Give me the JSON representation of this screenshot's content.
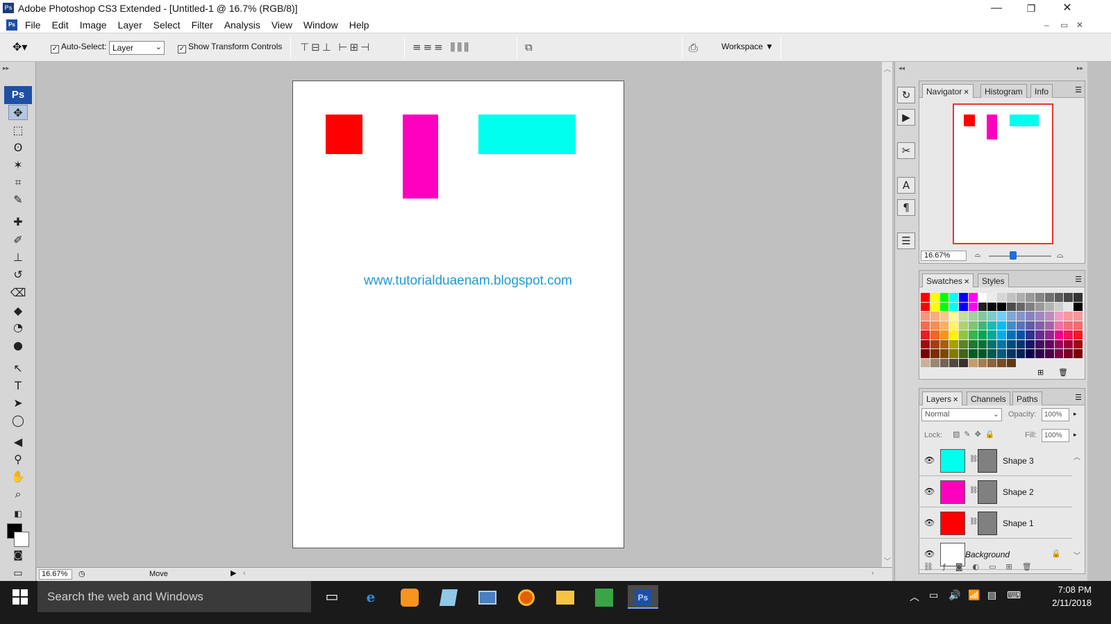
{
  "window": {
    "title": "Adobe Photoshop CS3 Extended - [Untitled-1 @ 16.7% (RGB/8)]",
    "app_icon": "Ps",
    "controls": {
      "minimize": "—",
      "restore": "❐",
      "close": "✕"
    }
  },
  "menu": {
    "items": [
      "File",
      "Edit",
      "Image",
      "Layer",
      "Select",
      "Filter",
      "Analysis",
      "View",
      "Window",
      "Help"
    ],
    "doc_controls": {
      "minimize": "–",
      "restore": "▭",
      "close": "✕"
    }
  },
  "options": {
    "auto_select_label": "Auto-Select:",
    "auto_select_checked": true,
    "auto_select_value": "Layer",
    "show_transform_label": "Show Transform Controls",
    "show_transform_checked": true,
    "workspace_label": "Workspace ▼"
  },
  "toolbox": {
    "logo": "Ps",
    "tools": [
      {
        "name": "move-tool",
        "glyph": "✥",
        "active": true
      },
      {
        "name": "marquee-tool",
        "glyph": "⬚",
        "active": false
      },
      {
        "name": "lasso-tool",
        "glyph": "ʘ",
        "active": false
      },
      {
        "name": "magic-wand-tool",
        "glyph": "✶",
        "active": false
      },
      {
        "name": "crop-tool",
        "glyph": "⌗",
        "active": false
      },
      {
        "name": "slice-tool",
        "glyph": "✎",
        "active": false
      },
      {
        "name": "healing-brush-tool",
        "glyph": "✚",
        "active": false
      },
      {
        "name": "brush-tool",
        "glyph": "✐",
        "active": false
      },
      {
        "name": "clone-stamp-tool",
        "glyph": "⊥",
        "active": false
      },
      {
        "name": "history-brush-tool",
        "glyph": "↺",
        "active": false
      },
      {
        "name": "eraser-tool",
        "glyph": "⌫",
        "active": false
      },
      {
        "name": "paint-bucket-tool",
        "glyph": "◆",
        "active": false
      },
      {
        "name": "blur-tool",
        "glyph": "◔",
        "active": false
      },
      {
        "name": "dodge-tool",
        "glyph": "●",
        "active": false
      },
      {
        "name": "path-selection-tool",
        "glyph": "↖",
        "active": false
      },
      {
        "name": "type-tool",
        "glyph": "T",
        "active": false
      },
      {
        "name": "direct-selection-tool",
        "glyph": "➤",
        "active": false
      },
      {
        "name": "ellipse-tool",
        "glyph": "◯",
        "active": false
      },
      {
        "name": "notes-tool",
        "glyph": "◀",
        "active": false
      },
      {
        "name": "eyedropper-tool",
        "glyph": "⚲",
        "active": false
      },
      {
        "name": "hand-tool",
        "glyph": "✋",
        "active": false
      },
      {
        "name": "zoom-tool",
        "glyph": "⌕",
        "active": false
      }
    ],
    "foreground_color": "#000000",
    "background_color": "#ffffff"
  },
  "canvas": {
    "shapes": [
      {
        "name": "shape-1-red",
        "color": "#ff0000"
      },
      {
        "name": "shape-2-magenta",
        "color": "#ff00bf"
      },
      {
        "name": "shape-3-cyan",
        "color": "#00ffee"
      }
    ],
    "watermark": "www.tutorialduaenam.blogspot.com"
  },
  "status": {
    "zoom": "16.67%",
    "tool": "Move"
  },
  "navigator": {
    "tabs": [
      "Navigator",
      "Histogram",
      "Info"
    ],
    "zoom": "16.67%"
  },
  "swatches": {
    "tabs": [
      "Swatches",
      "Styles"
    ],
    "rows": [
      [
        "#ff0000",
        "#ffff00",
        "#00ff00",
        "#00ffff",
        "#0000ff",
        "#ff00ff",
        "#ffffff",
        "#ebebeb",
        "#d6d6d6",
        "#c2c2c2",
        "#adadad",
        "#999999",
        "#858585",
        "#707070",
        "#5c5c5c",
        "#474747",
        "#333333"
      ],
      [
        "#ff0000",
        "#ffff00",
        "#00ff00",
        "#00ffff",
        "#0000ff",
        "#ff00ff",
        "#1f1f1f",
        "#0a0a0a",
        "#000000",
        "#4d4d4d",
        "#666666",
        "#808080",
        "#999999",
        "#b3b3b3",
        "#cccccc",
        "#e6e6e6",
        "#000000"
      ],
      [
        "#f7977a",
        "#f9ad81",
        "#fdc68a",
        "#fff79a",
        "#c4df9b",
        "#a2d39c",
        "#82ca9d",
        "#7bcdc8",
        "#6ecff6",
        "#7ea7d8",
        "#8493ca",
        "#8882be",
        "#a187be",
        "#bc8dbf",
        "#f49ac2",
        "#f6989d",
        "#f5989d"
      ],
      [
        "#f26c4f",
        "#f68e55",
        "#fbaf5c",
        "#fff467",
        "#acd372",
        "#7cc576",
        "#3bb878",
        "#1abbb4",
        "#00bff3",
        "#438cca",
        "#5574b9",
        "#605ca8",
        "#855fa8",
        "#a763a8",
        "#f06ea9",
        "#f26d7d",
        "#f26c6c"
      ],
      [
        "#ed1c24",
        "#f26522",
        "#f7941d",
        "#fff200",
        "#8dc73f",
        "#39b54a",
        "#00a651",
        "#00a99d",
        "#00aeef",
        "#0072bc",
        "#0054a6",
        "#2e3192",
        "#662d91",
        "#92278f",
        "#ec008c",
        "#ed145b",
        "#ed1c24"
      ],
      [
        "#9e0b0f",
        "#a0410d",
        "#a3620a",
        "#aba000",
        "#598527",
        "#1a7b30",
        "#007236",
        "#00746b",
        "#0076a3",
        "#004b80",
        "#003471",
        "#1b1464",
        "#440e62",
        "#630460",
        "#9e005d",
        "#9e0039",
        "#9e0b0f"
      ],
      [
        "#790000",
        "#7b2e00",
        "#7d4900",
        "#827b00",
        "#406618",
        "#005e20",
        "#005826",
        "#005952",
        "#005b7f",
        "#003663",
        "#002157",
        "#0d004c",
        "#32004b",
        "#4b0049",
        "#7b0046",
        "#7a0026",
        "#790000"
      ],
      [
        "#c7b299",
        "#998675",
        "#736357",
        "#534741",
        "#37302d",
        "#c69c6d",
        "#a67c52",
        "#8c6239",
        "#754c24",
        "#603913",
        "#e8e8e8",
        "#e8e8e8",
        "#e8e8e8",
        "#e8e8e8",
        "#e8e8e8",
        "#e8e8e8",
        "#e8e8e8"
      ]
    ]
  },
  "layers": {
    "tabs": [
      "Layers",
      "Channels",
      "Paths"
    ],
    "blend_mode": "Normal",
    "opacity_label": "Opacity:",
    "opacity_value": "100%",
    "lock_label": "Lock:",
    "fill_label": "Fill:",
    "fill_value": "100%",
    "items": [
      {
        "name": "Shape 3",
        "color": "#00ffee"
      },
      {
        "name": "Shape 2",
        "color": "#ff00bf"
      },
      {
        "name": "Shape 1",
        "color": "#ff0000"
      },
      {
        "name": "Background",
        "color": "#ffffff"
      }
    ]
  },
  "taskbar": {
    "search_placeholder": "Search the web and Windows",
    "time": "7:08 PM",
    "date": "2/11/2018"
  }
}
